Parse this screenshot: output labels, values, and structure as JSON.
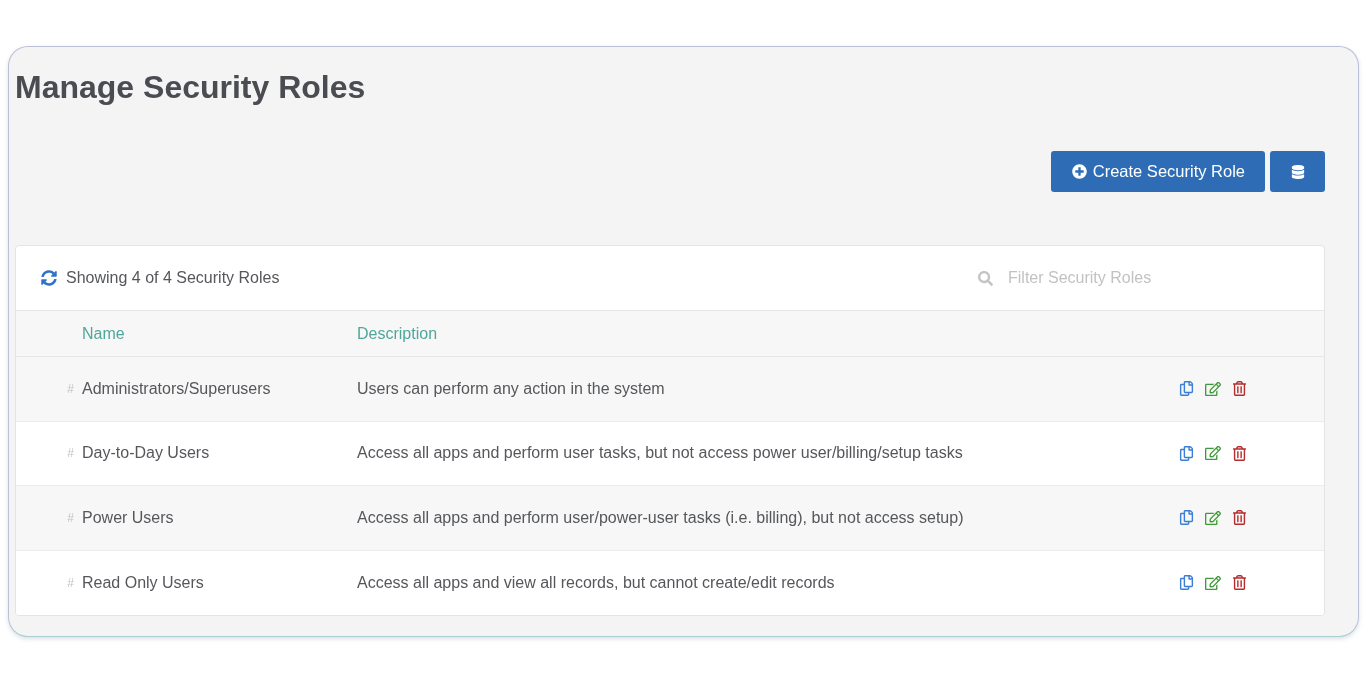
{
  "page": {
    "title": "Manage Security Roles"
  },
  "actions": {
    "create_button": "Create Security Role"
  },
  "table": {
    "summary": "Showing 4 of 4 Security Roles",
    "filter": {
      "placeholder": "Filter Security Roles"
    },
    "columns": [
      "Name",
      "Description"
    ],
    "rows": [
      {
        "marker": "#",
        "name": "Administrators/Superusers",
        "description": "Users can perform any action in the system"
      },
      {
        "marker": "#",
        "name": "Day-to-Day Users",
        "description": "Access all apps and perform user tasks, but not access power user/billing/setup tasks"
      },
      {
        "marker": "#",
        "name": "Power Users",
        "description": "Access all apps and perform user/power-user tasks (i.e. billing), but not access setup)"
      },
      {
        "marker": "#",
        "name": "Read Only Users",
        "description": "Access all apps and view all records, but cannot create/edit records"
      }
    ]
  }
}
